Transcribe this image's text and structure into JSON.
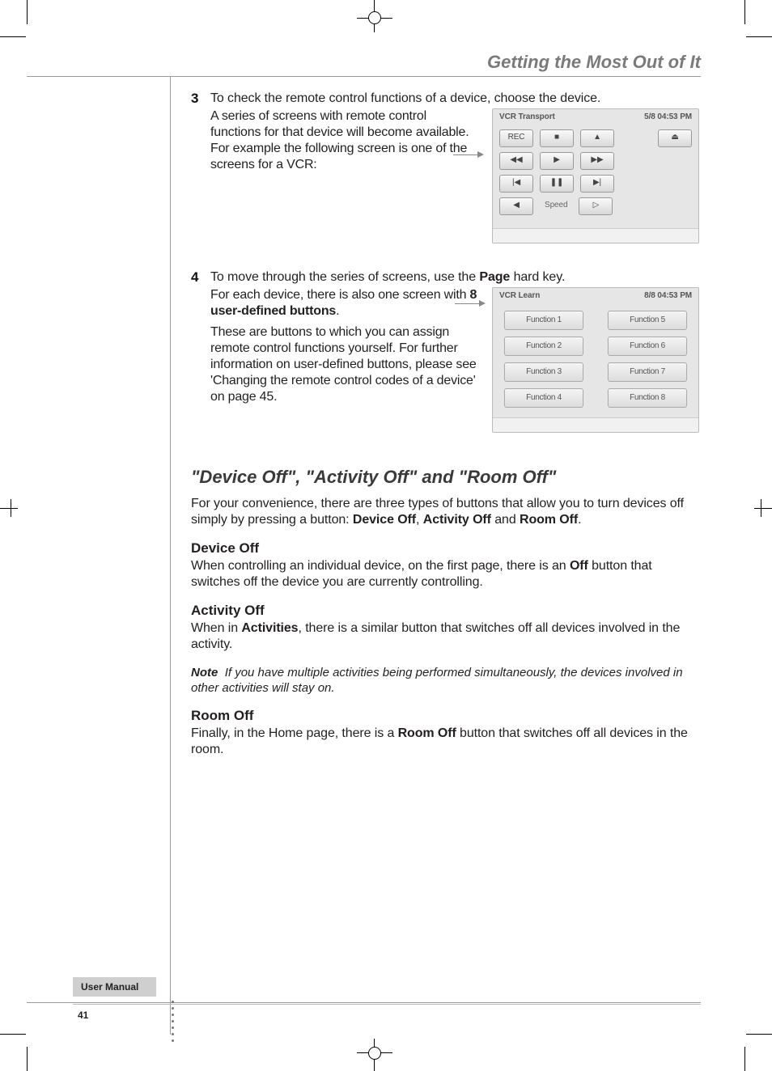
{
  "header": {
    "chapter_title": "Getting the Most Out of It"
  },
  "steps": {
    "s3": {
      "num": "3",
      "lead": "To check the remote control functions of a device, choose the device.",
      "body1": "A series of screens with remote control functions for that device will become available. For example the following screen is one of the screens for a VCR:"
    },
    "s4": {
      "num": "4",
      "lead_a": "To move through the series of screens, use the ",
      "lead_bold": "Page",
      "lead_b": " hard key.",
      "body1": "For each device, there is also one screen with ",
      "body1_bold": "8 user-defined buttons",
      "body1_end": ".",
      "body2": "These are buttons to which you can assign remote control functions yourself. For further information on user-defined buttons, please see 'Changing the remote control codes of a device' on page 45."
    }
  },
  "fig1": {
    "title": "VCR Transport",
    "clock": "5/8   04:53 PM",
    "buttons": {
      "r1": [
        "REC",
        "■",
        "▲",
        "⏏"
      ],
      "r2": [
        "◀◀",
        "▶",
        "▶▶"
      ],
      "r3": [
        "|◀",
        "❚❚",
        "▶|"
      ],
      "r4": [
        "◀",
        "Speed",
        "▷"
      ]
    }
  },
  "fig2": {
    "title": "VCR Learn",
    "clock": "8/8   04:53 PM",
    "buttons": [
      "Function 1",
      "Function 5",
      "Function 2",
      "Function 6",
      "Function 3",
      "Function 7",
      "Function 4",
      "Function 8"
    ]
  },
  "section": {
    "h2": "\"Device Off\", \"Activity Off\" and \"Room Off\"",
    "intro_a": "For your convenience, there are three types of buttons that allow you to turn devices off simply by pressing a button: ",
    "intro_b1": "Device Off",
    "intro_sep1": ", ",
    "intro_b2": "Activity Off",
    "intro_sep2": " and ",
    "intro_b3": "Room Off",
    "intro_end": ".",
    "dev_h": "Device Off",
    "dev_p_a": "When controlling an individual device, on the first page, there is an ",
    "dev_p_b": "Off",
    "dev_p_c": " button that switches off the device you are currently controlling.",
    "act_h": "Activity Off",
    "act_p_a": "When in ",
    "act_p_b": "Activities",
    "act_p_c": ", there is a similar button that switches off all devices involved in the activity.",
    "note_label": "Note",
    "note_body": "If you have multiple activities being performed simultaneously, the devices involved in other activities will stay on.",
    "room_h": "Room Off",
    "room_p_a": "Finally, in the Home page, there is a ",
    "room_p_b": "Room Off",
    "room_p_c": " button that switches off all devices in the room."
  },
  "footer": {
    "label": "User Manual",
    "page": "41"
  }
}
